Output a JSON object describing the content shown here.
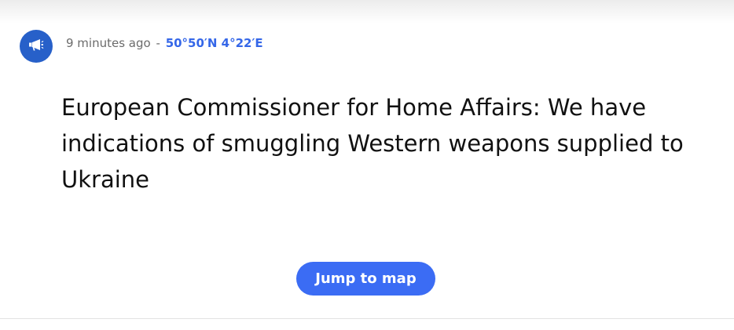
{
  "item": {
    "icon": "megaphone-icon",
    "time_ago": "9 minutes ago",
    "separator": "-",
    "coordinates": "50°50′N 4°22′E",
    "headline": "European Commissioner for Home Affairs: We have indications of smuggling Western weapons supplied to Ukraine",
    "button_label": "Jump to map"
  },
  "colors": {
    "accent": "#3b6cf4",
    "avatar": "#2760c9",
    "coords": "#3567e8"
  }
}
